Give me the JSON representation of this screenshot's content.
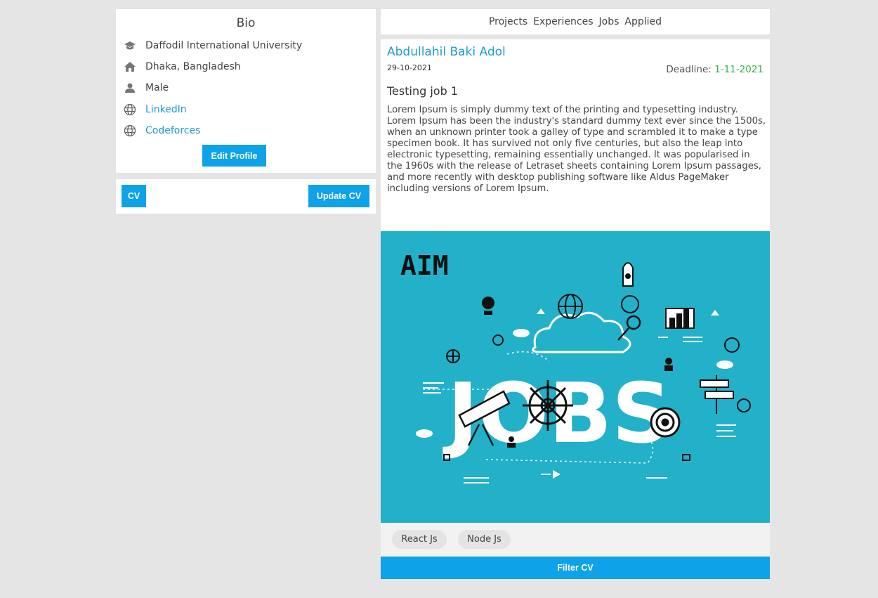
{
  "bio": {
    "title": "Bio",
    "university": "Daffodil International University",
    "location": "Dhaka, Bangladesh",
    "gender": "Male",
    "linkedin": "LinkedIn",
    "codeforces": "Codeforces",
    "edit_button": "Edit Profile"
  },
  "cv": {
    "cv_button": "CV",
    "update_button": "Update CV"
  },
  "nav": {
    "items": [
      "Projects",
      "Experiences",
      "Jobs",
      "Applied"
    ]
  },
  "job": {
    "author": "Abdullahil Baki Adol",
    "date": "29-10-2021",
    "deadline_label": "Deadline: ",
    "deadline_value": "1-11-2021",
    "title": "Testing job 1",
    "description": "Lorem Ipsum is simply dummy text of the printing and typesetting industry. Lorem Ipsum has been the industry's standard dummy text ever since the 1500s, when an unknown printer took a galley of type and scrambled it to make a type specimen book. It has survived not only five centuries, but also the leap into electronic typesetting, remaining essentially unchanged. It was popularised in the 1960s with the release of Letraset sheets containing Lorem Ipsum passages, and more recently with desktop publishing software like Aldus PageMaker including versions of Lorem Ipsum.",
    "image": {
      "logo_text": "AIM",
      "headline": "JOBS",
      "background_color": "#22b1c9"
    },
    "tags": [
      "React Js",
      "Node Js"
    ],
    "filter_button": "Filter CV"
  },
  "colors": {
    "accent": "#0ea2e8",
    "link": "#1c9bd6",
    "deadline": "#2eb04b"
  }
}
